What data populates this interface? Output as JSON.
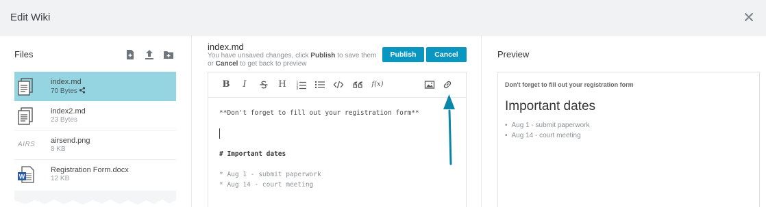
{
  "header": {
    "title": "Edit Wiki",
    "close_icon": "close-icon"
  },
  "files": {
    "title": "Files",
    "tools": [
      "new-file-icon",
      "upload-icon",
      "new-folder-icon"
    ],
    "items": [
      {
        "name": "index.md",
        "size": "70 Bytes",
        "shared": true,
        "icon": "document-icon",
        "selected": true
      },
      {
        "name": "index2.md",
        "size": "23 Bytes",
        "icon": "document-icon"
      },
      {
        "name": "airsend.png",
        "size": "8 KB",
        "thumb_text": "AIRS",
        "icon": "image-thumbnail"
      },
      {
        "name": "Registration Form.docx",
        "size": "12 KB",
        "icon": "word-icon"
      }
    ]
  },
  "editor": {
    "filename": "index.md",
    "message_parts": {
      "a": "You have unsaved changes, click ",
      "b": "Publish",
      "c": " to save them or ",
      "d": "Cancel",
      "e": " to get back to preview"
    },
    "publish_label": "Publish",
    "cancel_label": "Cancel",
    "toolbar": [
      "bold",
      "italic",
      "strikethrough",
      "heading",
      "ordered-list",
      "unordered-list",
      "code",
      "quote",
      "formula",
      "image",
      "link"
    ],
    "toolbar_glyphs": {
      "bold": "B",
      "italic": "I",
      "heading": "H",
      "formula": "f(x)"
    },
    "lines": [
      "**Don't forget to fill out your registration form**",
      "",
      "",
      "",
      "# Important dates",
      "",
      "* Aug 1 - submit paperwork",
      "* Aug 14 - court meeting"
    ]
  },
  "preview": {
    "title": "Preview",
    "bold_line": "Don't forget to fill out your registration form",
    "heading": "Important dates",
    "items": [
      "Aug 1 - submit paperwork",
      "Aug 14 - court meeting"
    ]
  },
  "colors": {
    "accent": "#0996c0",
    "selected_row": "#95d5e2",
    "arrow": "#0c86a8"
  }
}
